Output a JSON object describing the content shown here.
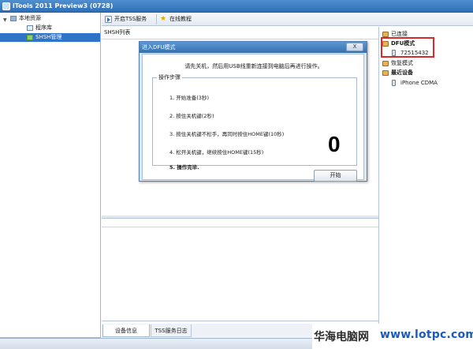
{
  "window": {
    "title": "iTools 2011 Preview3 (0728)"
  },
  "tree": {
    "root": "本地资源",
    "items": [
      {
        "label": "程序库"
      },
      {
        "label": "SHSH管理"
      }
    ]
  },
  "toolbar": {
    "tss": "开启TSS服务",
    "tutorial": "在线教程"
  },
  "list": {
    "header": "SHSH列表"
  },
  "devices": {
    "connected": "已连接",
    "dfu_group": "DFU模式",
    "dfu_device": "72515432",
    "recovery": "恢复模式",
    "recent": "最近设备",
    "recent_device": "iPhone CDMA"
  },
  "dialog": {
    "title": "进入DFU模式",
    "close": "X",
    "instruction": "请先关机，然后用USB线重新连接到电脑后再进行操作。",
    "group_label": "操作步骤",
    "steps": [
      "1. 开始准备(3秒)",
      "2. 按住关机键(2秒)",
      "3. 按住关机键不松手，再同时按住HOME键(10秒)",
      "4. 松开关机键，继续按住HOME键(15秒)",
      "5. 操作完毕."
    ],
    "countdown": "0",
    "start": "开始"
  },
  "tabs": {
    "info": "设备信息",
    "log": "TSS服务日志"
  },
  "watermark": {
    "cn": "华海电脑网",
    "url": "www.lotpc.com"
  },
  "colors": {
    "accent": "#2e74c8",
    "highlight_border": "#d92b2b",
    "titlebar": "#3a7bc2"
  }
}
